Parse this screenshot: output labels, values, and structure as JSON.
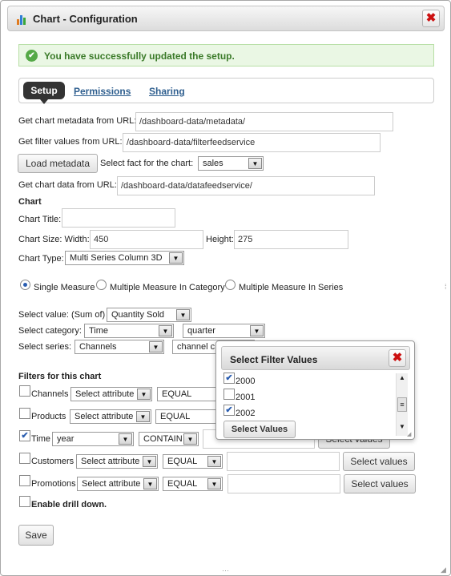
{
  "window": {
    "title": "Chart - Configuration"
  },
  "success_message": "You have successfully updated the setup.",
  "tabs": [
    {
      "label": "Setup"
    },
    {
      "label": "Permissions"
    },
    {
      "label": "Sharing"
    }
  ],
  "urls": {
    "metadata_label": "Get chart metadata from URL:",
    "metadata_value": "/dashboard-data/metadata/",
    "filter_label": "Get filter values from URL:",
    "filter_value": "/dashboard-data/filterfeedservice",
    "load_button": "Load metadata",
    "fact_label": "Select fact for the chart:",
    "fact_value": "sales",
    "data_label": "Get chart data from URL:",
    "data_value": "/dashboard-data/datafeedservice/"
  },
  "chart": {
    "heading": "Chart",
    "title_label": "Chart Title:",
    "title_value": "",
    "size_label": "Chart Size: Width:",
    "width_value": "450",
    "height_label": "Height:",
    "height_value": "275",
    "type_label": "Chart Type:",
    "type_value": "Multi Series Column 3D"
  },
  "measures": [
    {
      "label": "Single Measure",
      "selected": true
    },
    {
      "label": "Multiple Measure In Category",
      "selected": false
    },
    {
      "label": "Multiple Measure In Series",
      "selected": false
    }
  ],
  "selectors": {
    "value_label": "Select value: (Sum of)",
    "value_value": "Quantity Sold",
    "category_label": "Select category:",
    "category_value": "Time",
    "category_level": "quarter",
    "series_label": "Select series:",
    "series_value": "Channels",
    "series_level": "channel c"
  },
  "filters": {
    "heading": "Filters for this chart",
    "rows": [
      {
        "name": "Channels",
        "checked": false,
        "attribute": "Select attribute",
        "operator": "EQUAL",
        "button": ""
      },
      {
        "name": "Products",
        "checked": false,
        "attribute": "Select attribute",
        "operator": "EQUAL",
        "button": ""
      },
      {
        "name": "Time",
        "checked": true,
        "attribute": "year",
        "operator": "CONTAIN",
        "button": "Select values"
      },
      {
        "name": "Customers",
        "checked": false,
        "attribute": "Select attribute",
        "operator": "EQUAL",
        "button": "Select values"
      },
      {
        "name": "Promotions",
        "checked": false,
        "attribute": "Select attribute",
        "operator": "EQUAL",
        "button": "Select values"
      }
    ],
    "drill_label": "Enable drill down."
  },
  "save_button": "Save",
  "popup": {
    "title": "Select Filter Values",
    "items": [
      {
        "label": "2000",
        "checked": true
      },
      {
        "label": "2001",
        "checked": false
      },
      {
        "label": "2002",
        "checked": true
      }
    ],
    "button": "Select Values"
  },
  "colors": {
    "accent": "#2f5f8f",
    "success_bg": "#eaf7e4",
    "success_text": "#3a7a28",
    "close": "#cc1111"
  }
}
